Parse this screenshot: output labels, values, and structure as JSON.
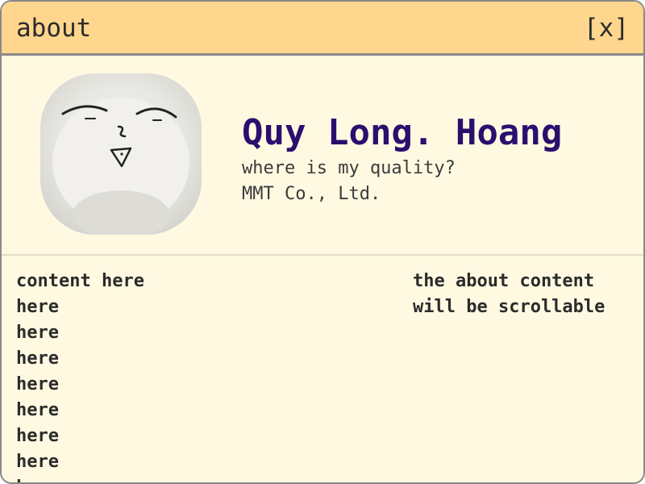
{
  "window": {
    "title": "about",
    "close_label": "[x]"
  },
  "profile": {
    "name": "Quy Long. Hoang",
    "tagline": "where is my quality?",
    "company": "MMT Co., Ltd."
  },
  "content": {
    "left_lines": [
      "content here",
      "here",
      "here",
      "here",
      "here",
      "here",
      "here",
      "here",
      "here"
    ],
    "right_lines": [
      "the about content",
      "will be scrollable"
    ]
  },
  "colors": {
    "titlebar": "#ffd68d",
    "background": "#fff9e1",
    "name": "#2a0f6e",
    "border": "#8a8a8a"
  }
}
